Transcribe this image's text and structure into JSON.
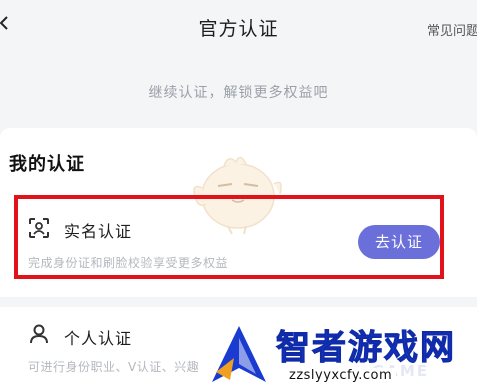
{
  "header": {
    "title": "官方认证",
    "faq_label": "常见问题"
  },
  "subtitle": "继续认证，解锁更多权益吧",
  "section_title": "我的认证",
  "items": [
    {
      "icon": "face-scan-icon",
      "label": "实名认证",
      "description": "完成身份证和刷脸校验享受更多权益",
      "action_label": "去认证"
    },
    {
      "icon": "person-icon",
      "label": "个人认证",
      "description": "可进行身份职业、V认证、兴趣"
    }
  ],
  "watermark": {
    "title": "智者游戏网",
    "url": "zzslyyxcfy.com",
    "game_text": "GAME"
  },
  "colors": {
    "accent_button": "#6b6fd9",
    "highlight_border": "#e2121b",
    "watermark_blue": "#1a3bd0"
  }
}
